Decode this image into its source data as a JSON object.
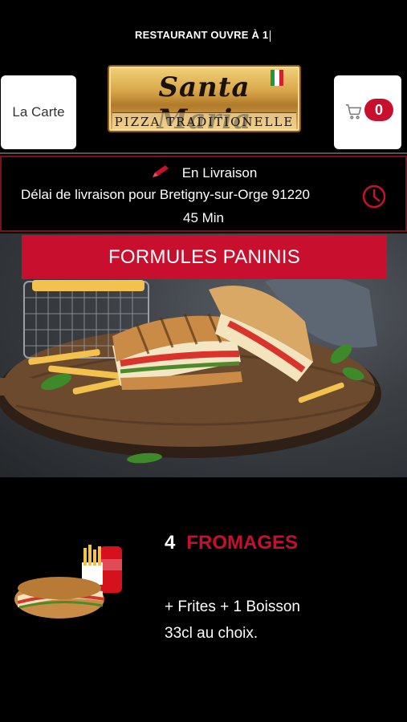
{
  "topbar": {
    "marquee": "RESTAURANT OUVRE À 1"
  },
  "header": {
    "carte_label": "La Carte",
    "logo": {
      "script": "Santa Maria",
      "subtitle": "PIZZA TRADITIONELLE"
    },
    "cart_count": "0"
  },
  "delivery": {
    "mode": "En Livraison",
    "delay": "Délai de livraison pour Bretigny-sur-Orge 91220",
    "time": "45 Min"
  },
  "category": {
    "title": "FORMULES PANINIS"
  },
  "product": {
    "number": "4",
    "name": "FROMAGES",
    "description": "+ Frites  + 1 Boisson 33cl au choix."
  },
  "colors": {
    "accent": "#c8102e",
    "background": "#000000",
    "gold": "#d9a64a"
  },
  "icons": [
    "pencil-icon",
    "cart-icon",
    "clock-icon",
    "italy-flag-icon"
  ]
}
